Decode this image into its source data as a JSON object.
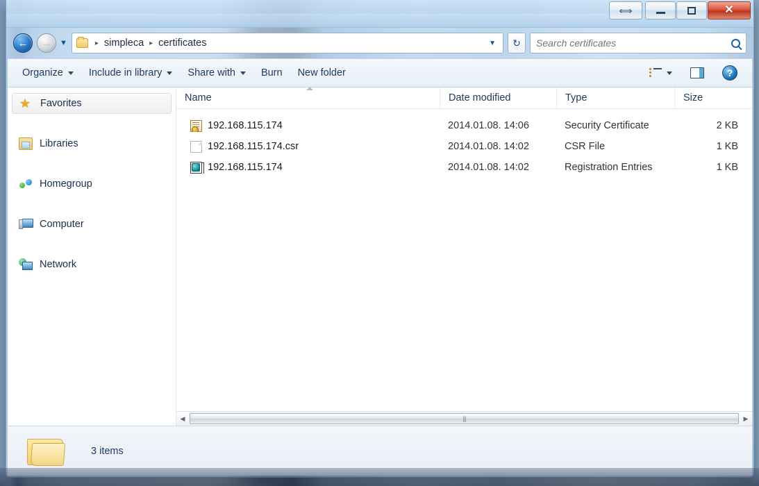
{
  "window": {
    "controls": {
      "resize_label": "⟺",
      "minimize_label": "−",
      "maximize_label": "□",
      "close_label": "✕"
    }
  },
  "addressbar": {
    "back_label": "←",
    "forward_label": "→",
    "recent_pages_label": "▼",
    "folder_icon": "folder-icon",
    "breadcrumbs": [
      "simpleca",
      "certificates"
    ],
    "separator": "▸",
    "dropdown_label": "▼",
    "refresh_label": "↻"
  },
  "search": {
    "placeholder": "Search certificates",
    "value": "",
    "icon": "search-icon"
  },
  "toolbar": {
    "items": [
      {
        "label": "Organize",
        "has_caret": true
      },
      {
        "label": "Include in library",
        "has_caret": true
      },
      {
        "label": "Share with",
        "has_caret": true
      },
      {
        "label": "Burn",
        "has_caret": false
      },
      {
        "label": "New folder",
        "has_caret": false
      }
    ],
    "view_options_label": "",
    "view_caret_label": "▼",
    "preview_pane_label": "",
    "help_label": "?"
  },
  "sidebar": {
    "items": [
      {
        "label": "Favorites",
        "icon": "star-icon",
        "selected": true
      },
      {
        "label": "Libraries",
        "icon": "libraries-icon",
        "selected": false
      },
      {
        "label": "Homegroup",
        "icon": "homegroup-icon",
        "selected": false
      },
      {
        "label": "Computer",
        "icon": "computer-icon",
        "selected": false
      },
      {
        "label": "Network",
        "icon": "network-icon",
        "selected": false
      }
    ]
  },
  "filelist": {
    "columns": [
      {
        "label": "Name",
        "sorted": true,
        "sort_direction": "ascending"
      },
      {
        "label": "Date modified",
        "sorted": false
      },
      {
        "label": "Type",
        "sorted": false
      },
      {
        "label": "Size",
        "sorted": false
      }
    ],
    "rows": [
      {
        "name": "192.168.115.174",
        "date_modified": "2014.01.08. 14:06",
        "type": "Security Certificate",
        "size": "2 KB",
        "icon": "security-certificate-icon"
      },
      {
        "name": "192.168.115.174.csr",
        "date_modified": "2014.01.08. 14:02",
        "type": "CSR File",
        "size": "1 KB",
        "icon": "blank-document-icon"
      },
      {
        "name": "192.168.115.174",
        "date_modified": "2014.01.08. 14:02",
        "type": "Registration Entries",
        "size": "1 KB",
        "icon": "registry-file-icon"
      }
    ]
  },
  "scrollbar": {
    "left_arrow_label": "◀",
    "right_arrow_label": "▶",
    "grip_label": "|||"
  },
  "statusbar": {
    "item_count": "3 items",
    "folder_icon": "folder-icon"
  },
  "colors": {
    "accent": "#1f5ea8",
    "close_button": "#c0392b",
    "glass": "#bad6f0",
    "text": "#1d3a5c"
  }
}
